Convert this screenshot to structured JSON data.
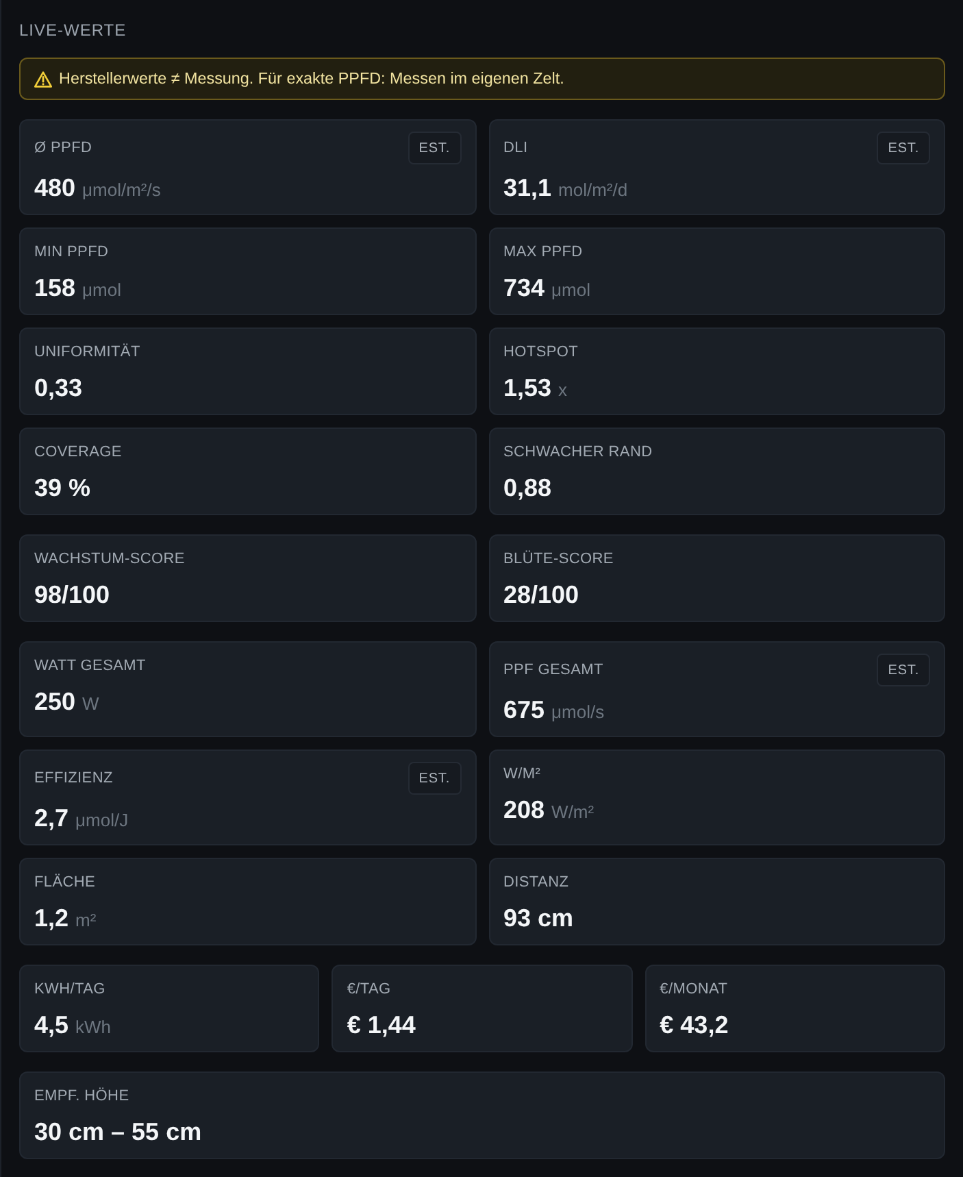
{
  "title": "LIVE-WERTE",
  "warning": {
    "text": "Herstellerwerte ≠ Messung. Für exakte PPFD: Messen im eigenen Zelt."
  },
  "groups": [
    {
      "cards": [
        {
          "label": "Ø PPFD",
          "value": "480",
          "unit": "μmol/m²/s",
          "badge": "EST."
        },
        {
          "label": "DLI",
          "value": "31,1",
          "unit": "mol/m²/d",
          "badge": "EST."
        },
        {
          "label": "MIN PPFD",
          "value": "158",
          "unit": "μmol"
        },
        {
          "label": "MAX PPFD",
          "value": "734",
          "unit": "μmol"
        },
        {
          "label": "UNIFORMITÄT",
          "value": "0,33"
        },
        {
          "label": "HOTSPOT",
          "value": "1,53",
          "unit": "x"
        },
        {
          "label": "COVERAGE",
          "value": "39 %"
        },
        {
          "label": "SCHWACHER RAND",
          "value": "0,88"
        }
      ]
    },
    {
      "cards": [
        {
          "label": "WACHSTUM-SCORE",
          "value": "98/100"
        },
        {
          "label": "BLÜTE-SCORE",
          "value": "28/100"
        }
      ]
    },
    {
      "cards": [
        {
          "label": "WATT GESAMT",
          "value": "250",
          "unit": "W"
        },
        {
          "label": "PPF GESAMT",
          "value": "675",
          "unit": "μmol/s",
          "badge": "EST."
        },
        {
          "label": "EFFIZIENZ",
          "value": "2,7",
          "unit": "μmol/J",
          "badge": "EST."
        },
        {
          "label": "W/M²",
          "value": "208",
          "unit": "W/m²"
        },
        {
          "label": "FLÄCHE",
          "value": "1,2",
          "unit": "m²"
        },
        {
          "label": "DISTANZ",
          "value": "93 cm"
        }
      ]
    },
    {
      "cards": [
        {
          "label": "KWH/TAG",
          "value": "4,5",
          "unit": "kWh"
        },
        {
          "label": "€/TAG",
          "value": "€ 1,44"
        },
        {
          "label": "€/MONAT",
          "value": "€ 43,2"
        }
      ]
    },
    {
      "cards": [
        {
          "label": "EMPF. HÖHE",
          "value": "30 cm – 55 cm"
        }
      ]
    }
  ]
}
